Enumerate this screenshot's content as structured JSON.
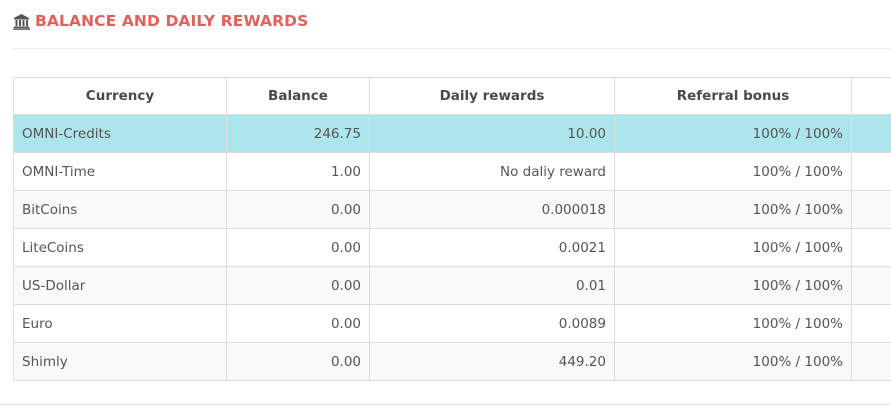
{
  "heading": {
    "title": "BALANCE AND DAILY REWARDS",
    "icon": "bank-icon",
    "title_color": "#e0625b"
  },
  "table": {
    "columns": [
      "Currency",
      "Balance",
      "Daily rewards",
      "Referral bonus",
      ""
    ],
    "rows": [
      {
        "currency": "OMNI-Credits",
        "balance": "246.75",
        "daily": "10.00",
        "referral": "100% / 100%",
        "highlighted": true
      },
      {
        "currency": "OMNI-Time",
        "balance": "1.00",
        "daily": "No daliy reward",
        "referral": "100% / 100%"
      },
      {
        "currency": "BitCoins",
        "balance": "0.00",
        "daily": "0.000018",
        "referral": "100% / 100%"
      },
      {
        "currency": "LiteCoins",
        "balance": "0.00",
        "daily": "0.0021",
        "referral": "100% / 100%"
      },
      {
        "currency": "US-Dollar",
        "balance": "0.00",
        "daily": "0.01",
        "referral": "100% / 100%"
      },
      {
        "currency": "Euro",
        "balance": "0.00",
        "daily": "0.0089",
        "referral": "100% / 100%"
      },
      {
        "currency": "Shimly",
        "balance": "0.00",
        "daily": "449.20",
        "referral": "100% / 100%"
      }
    ],
    "highlight_color": "#ade5ec"
  }
}
